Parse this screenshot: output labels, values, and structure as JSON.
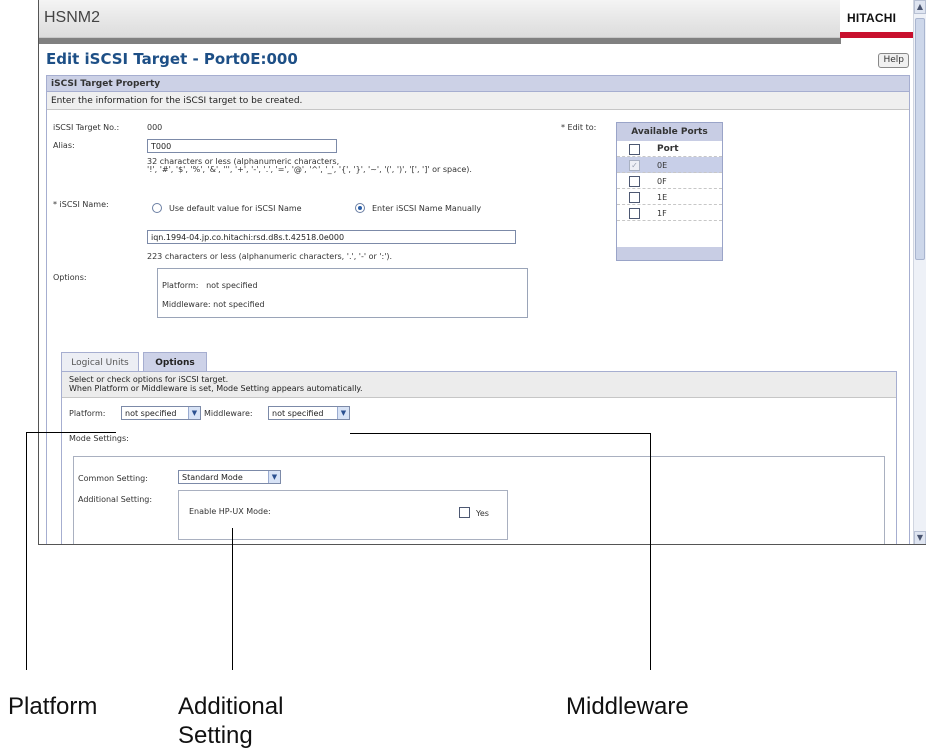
{
  "window": {
    "app_name": "HSNM2",
    "brand": "HITACHI",
    "brand_color": "#c8102e"
  },
  "page": {
    "title": "Edit iSCSI Target - Port0E:000",
    "help_label": "Help"
  },
  "property": {
    "heading": "iSCSI Target Property",
    "instruction": "Enter the information for the iSCSI target to be created.",
    "target_no_label": "iSCSI Target No.:",
    "target_no_value": "000",
    "alias_label": "Alias:",
    "alias_value": "T000",
    "alias_hint_1": "32 characters or less (alphanumeric characters,",
    "alias_hint_2": "'!', '#', '$', '%', '&', ''', '+', '-', '.', '=', '@', '^', '_', '{', '}', '~', '(', ')', '[', ']' or space).",
    "name_label": "* iSCSI Name:",
    "radio_default": "Use default value for iSCSI Name",
    "radio_manual": "Enter iSCSI Name Manually",
    "name_value": "iqn.1994-04.jp.co.hitachi:rsd.d8s.t.42518.0e000",
    "name_hint": "223 characters or less (alphanumeric characters, '.', '-' or ':').",
    "options_label": "Options:",
    "platform_line": "Platform:   not specified",
    "middleware_line": "Middleware: not specified",
    "edit_to_label": "* Edit to:"
  },
  "ports": {
    "heading": "Available Ports",
    "column": "Port",
    "rows": [
      "0E",
      "0F",
      "1E",
      "1F"
    ]
  },
  "tabs": {
    "logical_units": "Logical Units",
    "options": "Options"
  },
  "options_tab": {
    "desc_1": "Select or check options for iSCSI target.",
    "desc_2": "When Platform or Middleware is set, Mode Setting appears automatically.",
    "platform_label": "Platform:",
    "platform_value": "not specified",
    "middleware_label": "Middleware:",
    "middleware_value": "not specified",
    "mode_settings_label": "Mode Settings:",
    "common_label": "Common Setting:",
    "common_value": "Standard Mode",
    "additional_label": "Additional Setting:",
    "hpux_label": "Enable HP-UX Mode:",
    "yes_label": "Yes"
  },
  "callouts": {
    "platform": "Platform",
    "additional_1": "Additional",
    "additional_2": "Setting",
    "middleware": "Middleware"
  },
  "icons": {
    "dropdown": "chevron-down-icon",
    "scroll_up": "arrow-up-icon",
    "scroll_down": "arrow-down-icon"
  }
}
